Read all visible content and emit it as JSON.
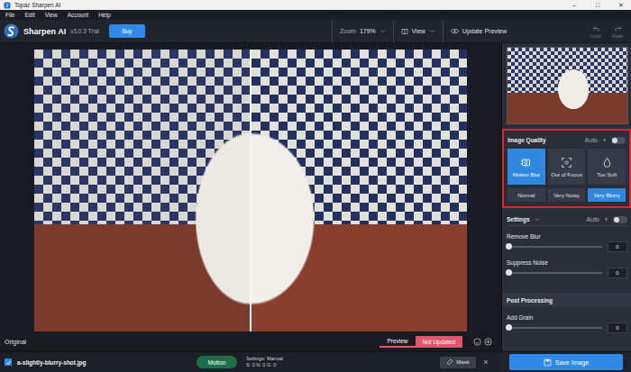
{
  "window": {
    "title": "Topaz Sharpen AI",
    "controls": [
      "–",
      "□",
      "✕"
    ]
  },
  "menu": [
    "File",
    "Edit",
    "View",
    "Account",
    "Help"
  ],
  "app": {
    "name": "Sharpen AI",
    "version": "v3.0.3 Trial",
    "buy": "Buy"
  },
  "toolbar": {
    "zoom_label": "Zoom",
    "zoom_value": "179%",
    "view": "View",
    "update": "Update Preview",
    "undo": "Undo",
    "redo": "Redo"
  },
  "canvas": {
    "left_label": "Original",
    "tabs": [
      {
        "label": "Preview",
        "selected": true
      },
      {
        "label": "Not Updated",
        "selected": false
      }
    ]
  },
  "image_quality": {
    "title": "Image Quality",
    "auto_label": "Auto",
    "auto_on": false,
    "highlighted": true,
    "types": [
      {
        "label": "Motion Blur",
        "selected": true
      },
      {
        "label": "Out of Focus",
        "selected": false
      },
      {
        "label": "Too Soft",
        "selected": false
      }
    ],
    "levels": [
      {
        "label": "Normal",
        "selected": false
      },
      {
        "label": "Very Noisy",
        "selected": false
      },
      {
        "label": "Very Blurry",
        "selected": true
      }
    ]
  },
  "settings": {
    "title": "Settings",
    "auto_label": "Auto",
    "auto_on": false,
    "sliders": [
      {
        "label": "Remove Blur",
        "level": 0,
        "value": "0"
      },
      {
        "label": "Suppress Noise",
        "level": 0,
        "value": "0"
      }
    ]
  },
  "post_processing": {
    "title": "Post Processing",
    "sliders": [
      {
        "label": "Add Grain",
        "level": 0,
        "value": "0"
      }
    ]
  },
  "bottom": {
    "checked": true,
    "file": "a-slightly-blurry-shot.jpg",
    "mode": "Motion",
    "settings_label": "Settings: Manual",
    "settings_values": "S: 0 N: 0 G: 0",
    "mask": "Mask",
    "close": "×",
    "save": "Save Image"
  }
}
